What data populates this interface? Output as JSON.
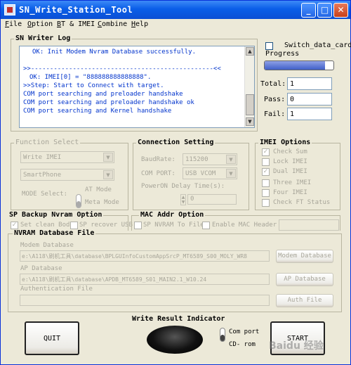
{
  "window": {
    "title": "SN_Write_Station_Tool"
  },
  "menu": [
    "File",
    "Option",
    "BT & IMEI",
    "Combine",
    "Help"
  ],
  "log": {
    "title": "SN Writer Log",
    "lines": [
      "OK: Init Modem Nvram Database successfully.",
      "",
      ">>------------------------------------------------<<",
      "  OK: IMEI[0] = \"888888888888888\".",
      ">>Step: Start to Connect with target.",
      "COM port searching and preloader handshake",
      "COM port searching and preloader handshake ok",
      "COM port searching and Kernel handshake"
    ]
  },
  "progress": {
    "switch_label": "Switch_data_card",
    "label": "Progress",
    "fraction": 0.88
  },
  "counters": [
    {
      "label": "Total:",
      "value": "1"
    },
    {
      "label": "Pass:",
      "value": "0"
    },
    {
      "label": "Fail:",
      "value": "1"
    }
  ],
  "function_select": {
    "title": "Function Select",
    "write_value": "Write IMEI",
    "phone_value": "SmartPhone",
    "mode_label": "MODE Select:",
    "mode_options": [
      "AT Mode",
      "Meta Mode"
    ]
  },
  "connection": {
    "title": "Connection Setting",
    "baudrate_label": "BaudRate:",
    "baudrate_value": "115200",
    "comport_label": "COM PORT:",
    "comport_value": "USB VCOM",
    "delay_label": "PowerON Delay Time(s):",
    "delay_value": "0"
  },
  "imei_options": {
    "title": "IMEI Options",
    "items": [
      {
        "label": "Check Sum",
        "checked": true
      },
      {
        "label": "Lock IMEI",
        "checked": false
      },
      {
        "label": "Dual IMEI",
        "checked": true
      },
      {
        "label": "Three IMEI",
        "checked": false
      },
      {
        "label": "Four IMEI",
        "checked": false
      },
      {
        "label": "Check FT Status",
        "checked": false
      }
    ]
  },
  "sp_backup": {
    "title": "SP Backup Nvram Option",
    "items": [
      {
        "label": "Set clean Bod",
        "checked": true
      },
      {
        "label": "SP recover USB",
        "checked": false
      }
    ]
  },
  "mac": {
    "title": "MAC Addr Option",
    "items": [
      {
        "label": "SP NVRAM To File",
        "checked": false
      },
      {
        "label": "Enable MAC Header",
        "checked": false
      }
    ]
  },
  "nvram": {
    "title": "NVRAM Database File",
    "modem_label": "Modem Database",
    "modem_path": "e:\\A118\\刷机工具\\database\\BPLGUInfoCustomAppSrcP_MT6589_S00_MOLY_WR8",
    "modem_btn": "Modem Database",
    "ap_label": "AP Database",
    "ap_path": "e:\\A118\\刷机工具\\database\\APDB_MT6589_S01_MAIN2.1_W10.24",
    "ap_btn": "AP Database",
    "auth_label": "Authentication File",
    "auth_path": "",
    "auth_btn": "Auth File"
  },
  "result": {
    "title": "Write Result Indicator",
    "com_port": "Com port",
    "cd_rom": "CD- rom"
  },
  "buttons": {
    "quit": "QUIT",
    "start": "START"
  },
  "watermark": "Baidu 经验"
}
